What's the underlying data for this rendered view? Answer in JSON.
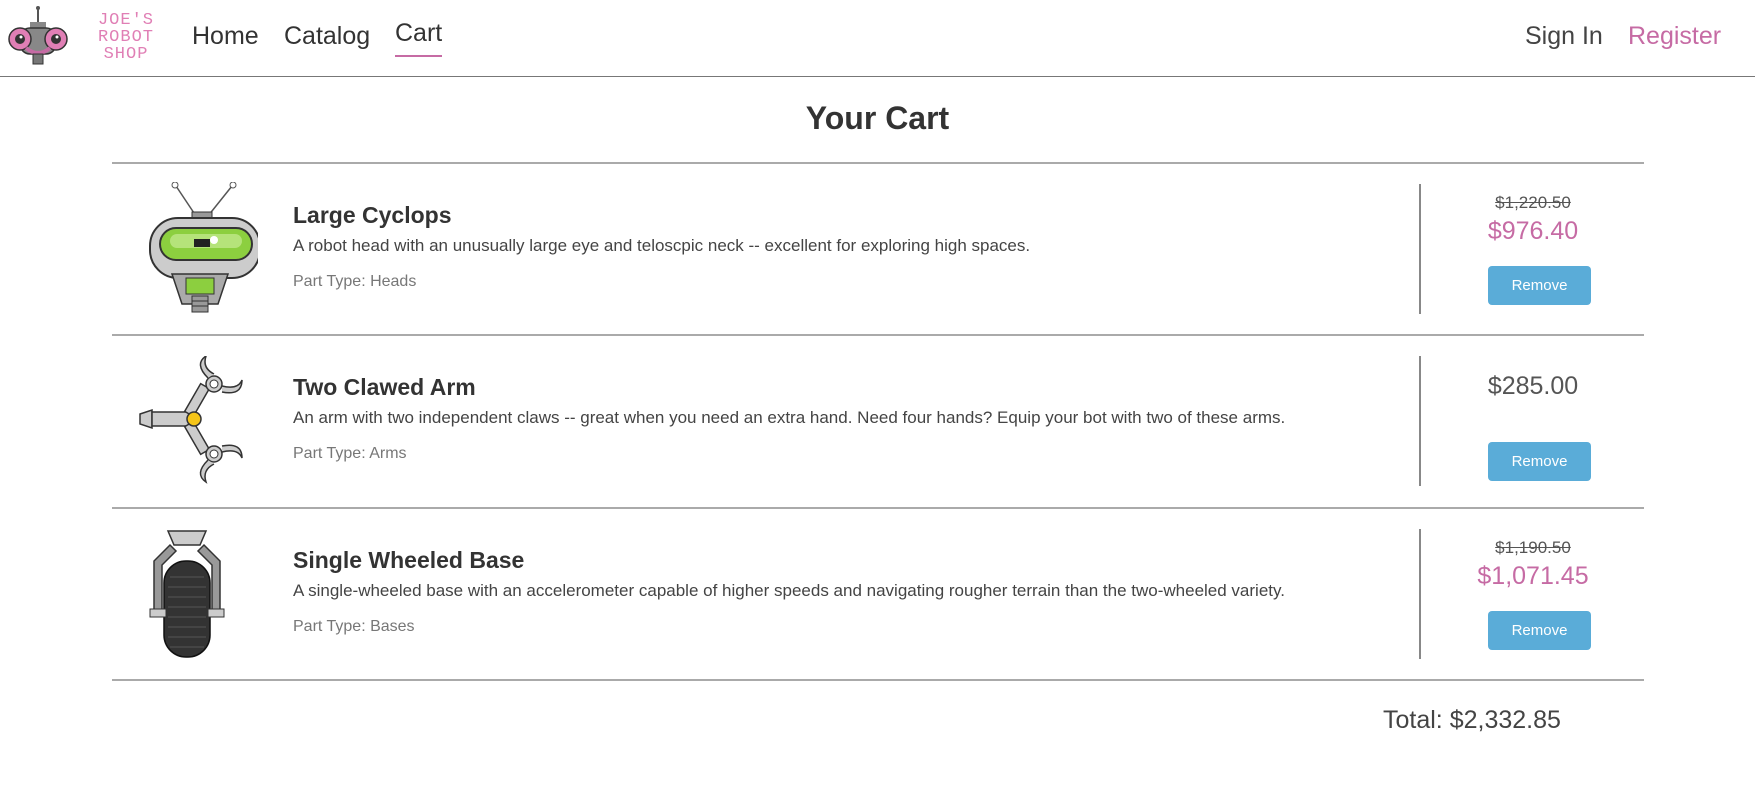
{
  "brand": {
    "logo_line1": "JOE'S",
    "logo_line2": "ROBOT",
    "logo_line3": "SHOP",
    "accent": "#c66ba4"
  },
  "nav": {
    "home": "Home",
    "catalog": "Catalog",
    "cart": "Cart",
    "sign_in": "Sign In",
    "register": "Register"
  },
  "page": {
    "title": "Your Cart"
  },
  "cart": {
    "items": [
      {
        "title": "Large Cyclops",
        "description": "A robot head with an unusually large eye and teloscpic neck -- excellent for exploring high spaces.",
        "part_type": "Part Type: Heads",
        "original_price": "$1,220.50",
        "price": "$976.40",
        "remove_label": "Remove",
        "icon": "large-cyclops-head-image"
      },
      {
        "title": "Two Clawed Arm",
        "description": "An arm with two independent claws -- great when you need an extra hand. Need four hands? Equip your bot with two of these arms.",
        "part_type": "Part Type: Arms",
        "price": "$285.00",
        "remove_label": "Remove",
        "icon": "two-clawed-arm-image"
      },
      {
        "title": "Single Wheeled Base",
        "description": "A single-wheeled base with an accelerometer capable of higher speeds and navigating rougher terrain than the two-wheeled variety.",
        "part_type": "Part Type: Bases",
        "original_price": "$1,190.50",
        "price": "$1,071.45",
        "remove_label": "Remove",
        "icon": "single-wheeled-base-image"
      }
    ],
    "total": "Total: $2,332.85",
    "button_color": "#5aacd8"
  }
}
